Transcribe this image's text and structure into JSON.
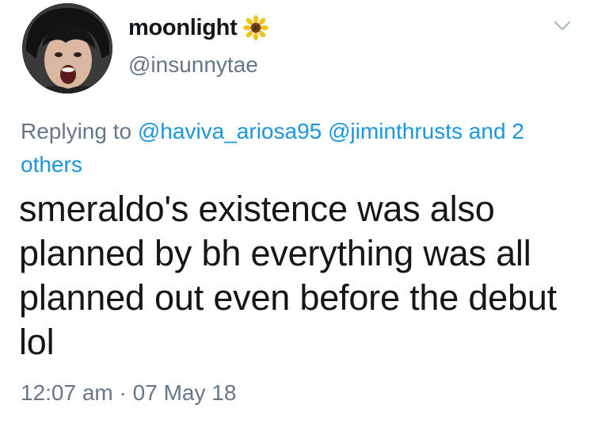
{
  "user": {
    "display_name": "moonlight",
    "handle": "@insunnytae",
    "name_emoji": "sunflower-emoji",
    "avatar": "profile-photo"
  },
  "reply": {
    "prefix": "Replying to",
    "mentions": [
      "@haviva_ariosa95",
      "@jiminthrusts"
    ],
    "others_text": "and 2 others"
  },
  "tweet": {
    "text_lines": [
      "smeraldo's existence was also",
      "planned by bh everything was all",
      "planned out even before the debut",
      "lol"
    ],
    "time": "12:07 am",
    "separator": "·",
    "date": "07 May 18"
  },
  "icons": {
    "menu": "chevron-down-icon"
  },
  "colors": {
    "text": "#14171a",
    "secondary": "#657786",
    "link": "#1b95e0",
    "background": "#ffffff"
  }
}
